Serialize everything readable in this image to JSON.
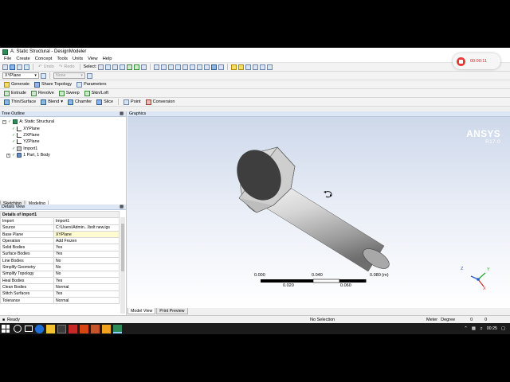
{
  "window": {
    "title": "A: Static Structural - DesignModeler"
  },
  "menu": [
    "File",
    "Create",
    "Concept",
    "Tools",
    "Units",
    "View",
    "Help"
  ],
  "toolbar1": {
    "undo_label": "Undo",
    "redo_label": "Redo",
    "select_label": "Select:"
  },
  "toolbar2": {
    "plane_value": "XYPlane",
    "sketch_value": "None"
  },
  "toolbar3": {
    "generate_label": "Generate",
    "share_label": "Share Topology",
    "parameters_label": "Parameters"
  },
  "toolbar4": {
    "extrude_label": "Extrude",
    "revolve_label": "Revolve",
    "sweep_label": "Sweep",
    "skin_label": "Skin/Loft"
  },
  "toolbar5": {
    "thin_label": "Thin/Surface",
    "blend_label": "Blend",
    "chamfer_label": "Chamfer",
    "slice_label": "Slice",
    "point_label": "Point",
    "conversion_label": "Conversion"
  },
  "tree": {
    "header": "Tree Outline",
    "items": [
      {
        "label": "A: Static Structural"
      },
      {
        "label": "XYPlane"
      },
      {
        "label": "ZXPlane"
      },
      {
        "label": "YZPlane"
      },
      {
        "label": "Import1"
      },
      {
        "label": "1 Part, 1 Body"
      }
    ]
  },
  "left_tabs": {
    "sketching": "Sketching",
    "modeling": "Modeling"
  },
  "details": {
    "header": "Details View",
    "title_row": "Details of Import1",
    "rows": [
      {
        "k": "Import",
        "v": "Import1"
      },
      {
        "k": "Source",
        "v": "C:\\Users\\Admin...\\bolt new.igs"
      },
      {
        "k": "Base Plane",
        "v": "XYPlane"
      },
      {
        "k": "Operation",
        "v": "Add Frozen"
      },
      {
        "k": "Solid Bodies",
        "v": "Yes"
      },
      {
        "k": "Surface Bodies",
        "v": "Yes"
      },
      {
        "k": "Line Bodies",
        "v": "No"
      },
      {
        "k": "Simplify Geometry",
        "v": "No"
      },
      {
        "k": "Simplify Topology",
        "v": "No"
      },
      {
        "k": "Heal Bodies",
        "v": "Yes"
      },
      {
        "k": "Clean Bodies",
        "v": "Normal"
      },
      {
        "k": "Stitch Surfaces",
        "v": "Yes"
      },
      {
        "k": "Tolerance",
        "v": "Normal"
      }
    ]
  },
  "graphics": {
    "header": "Graphics",
    "brand": "ANSYS",
    "version": "R17.0",
    "scale_top": [
      "0.000",
      "0.040",
      "0.080 (m)"
    ],
    "scale_bottom": [
      "0.020",
      "0.060"
    ],
    "tabs": {
      "model_view": "Model View",
      "print_preview": "Print Preview"
    },
    "triad": {
      "x": "X",
      "y": "Y",
      "z": "Z"
    }
  },
  "status": {
    "ready": "Ready",
    "selection": "No Selection",
    "units": "Meter",
    "angle": "Degree",
    "coords": "0",
    "coords2": "0"
  },
  "taskbar": {
    "time": "00:25"
  },
  "recorder": {
    "time": "00:00:11"
  }
}
